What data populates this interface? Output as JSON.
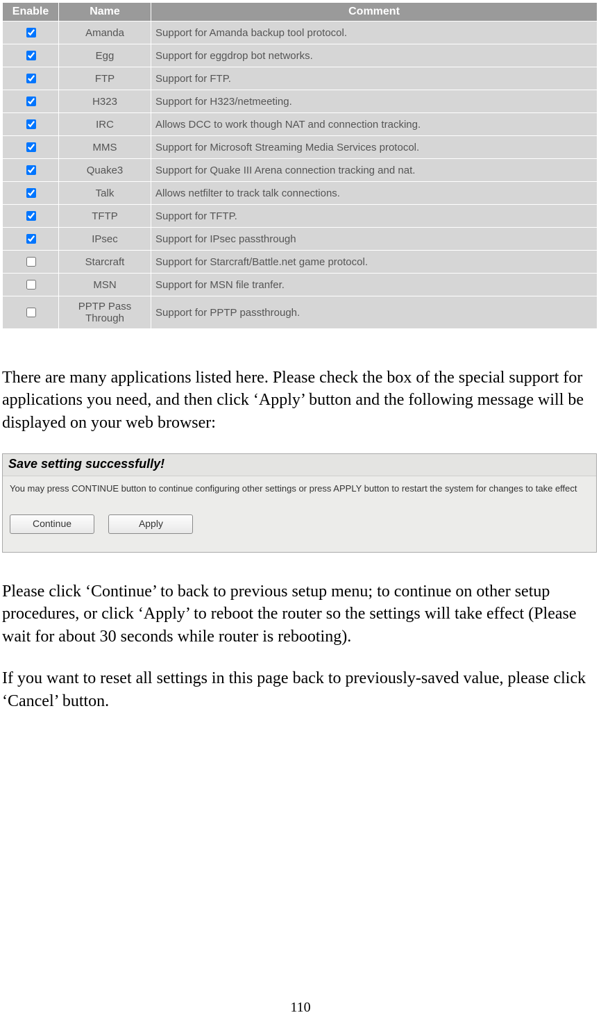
{
  "table": {
    "headers": {
      "enable": "Enable",
      "name": "Name",
      "comment": "Comment"
    },
    "rows": [
      {
        "checked": true,
        "name": "Amanda",
        "comment": "Support for Amanda backup tool protocol."
      },
      {
        "checked": true,
        "name": "Egg",
        "comment": "Support for eggdrop bot networks."
      },
      {
        "checked": true,
        "name": "FTP",
        "comment": "Support for FTP."
      },
      {
        "checked": true,
        "name": "H323",
        "comment": "Support for H323/netmeeting."
      },
      {
        "checked": true,
        "name": "IRC",
        "comment": "Allows DCC to work though NAT and connection tracking."
      },
      {
        "checked": true,
        "name": "MMS",
        "comment": "Support for Microsoft Streaming Media Services protocol."
      },
      {
        "checked": true,
        "name": "Quake3",
        "comment": "Support for Quake III Arena connection tracking and nat."
      },
      {
        "checked": true,
        "name": "Talk",
        "comment": "Allows netfilter to track talk connections."
      },
      {
        "checked": true,
        "name": "TFTP",
        "comment": "Support for TFTP."
      },
      {
        "checked": true,
        "name": "IPsec",
        "comment": "Support for IPsec passthrough"
      },
      {
        "checked": false,
        "name": "Starcraft",
        "comment": "Support for Starcraft/Battle.net game protocol."
      },
      {
        "checked": false,
        "name": "MSN",
        "comment": "Support for MSN file tranfer."
      },
      {
        "checked": false,
        "name": "PPTP Pass Through",
        "comment": "Support for PPTP passthrough."
      }
    ]
  },
  "paragraphs": {
    "p1": "There are many applications listed here. Please check the box of the special support for applications you need, and then click ‘Apply’ button and the following message will be displayed on your web browser:",
    "p2": "Please click ‘Continue’ to back to previous setup menu; to continue on other setup procedures, or click ‘Apply’ to reboot the router so the settings will take effect (Please wait for about 30 seconds while router is rebooting).",
    "p3": "If you want to reset all settings in this page back to previously-saved value, please click ‘Cancel’ button."
  },
  "dialog": {
    "title": "Save setting successfully!",
    "message": "You may press CONTINUE button to continue configuring other settings or press APPLY button to restart the system for changes to take effect",
    "continue": "Continue",
    "apply": "Apply"
  },
  "page_number": "110"
}
